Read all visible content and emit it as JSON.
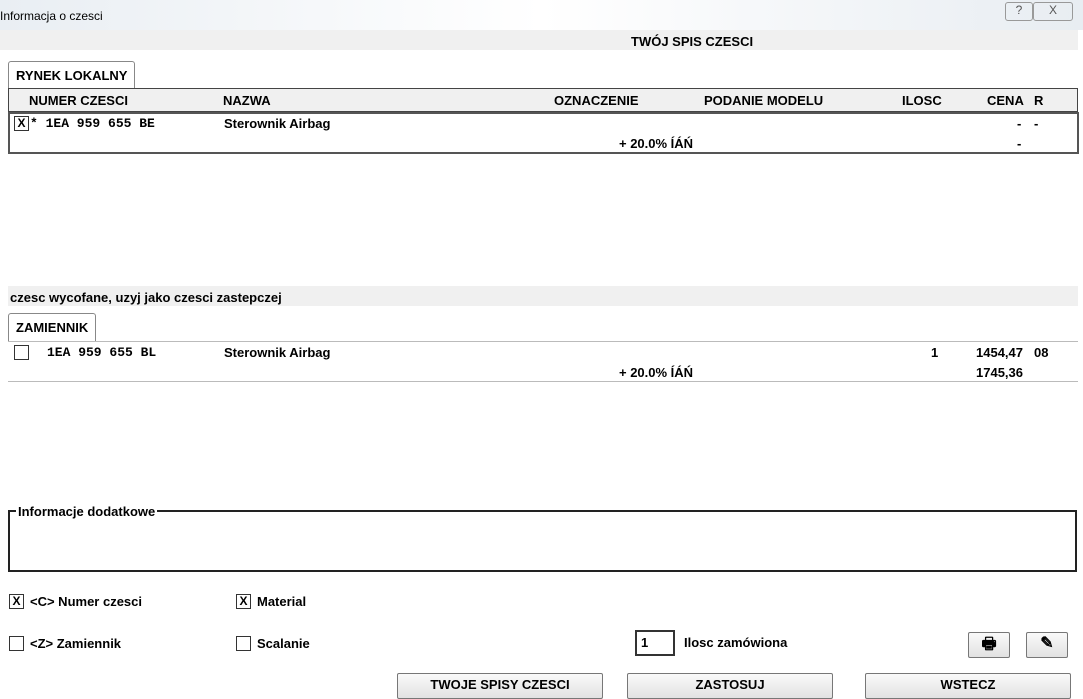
{
  "window": {
    "title": "Informacja o czesci",
    "help": "?",
    "close": "X"
  },
  "header": {
    "title": "TWÓJ SPIS CZESCI"
  },
  "tab_local": "RYNEK LOKALNY",
  "columns": [
    "NUMER CZESCI",
    "NAZWA",
    "OZNACZENIE",
    "PODANIE MODELU",
    "ILOSC",
    "CENA",
    "R"
  ],
  "local_row": {
    "checked": "X",
    "part": "* 1EA 959 655 BE",
    "name": "Sterownik Airbag",
    "vat": "+ 20.0% ÍÁŃ",
    "cena": "-",
    "r": "-",
    "cena2": "-"
  },
  "notice": "czesc wycofane, uzyj jako czesci zastepczej",
  "tab_sub": "ZAMIENNIK",
  "sub_row": {
    "part": "1EA 959 655 BL",
    "name": "Sterownik Airbag",
    "qty": "1",
    "cena": "1454,47",
    "r": "08",
    "vat": "+ 20.0% ÍÁŃ",
    "cena2": "1745,36"
  },
  "info_label": "Informacje dodatkowe",
  "options": {
    "numer": "<C> Numer czesci",
    "material": "Material",
    "zamiennik": "<Z> Zamiennik",
    "scalanie": "Scalanie",
    "check": "X"
  },
  "qty": {
    "value": "1",
    "label": "Ilosc zamówiona"
  },
  "buttons": {
    "lists": "TWOJE SPISY CZESCI",
    "apply": "ZASTOSUJ",
    "back": "WSTECZ"
  }
}
